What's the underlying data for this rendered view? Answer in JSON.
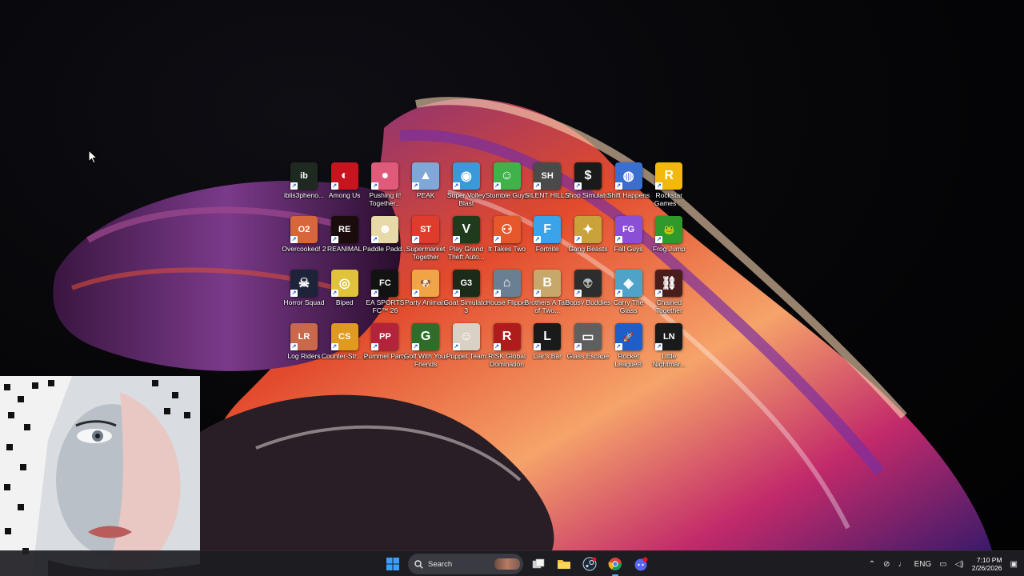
{
  "desktop": {
    "icons": [
      {
        "label": "iblis3pheno...",
        "color": "#1e2a20",
        "glyph": "ib",
        "icon": "iblis-icon"
      },
      {
        "label": "Among Us",
        "color": "#c8141e",
        "glyph": "◐",
        "icon": "among-us-icon"
      },
      {
        "label": "Pushing it! Together...",
        "color": "#e05a7a",
        "glyph": "●",
        "icon": "pushing-it-icon"
      },
      {
        "label": "PEAK",
        "color": "#7fa8d6",
        "glyph": "▲",
        "icon": "peak-icon"
      },
      {
        "label": "Super Volley Blast",
        "color": "#3a9ad9",
        "glyph": "◉",
        "icon": "volleyball-icon"
      },
      {
        "label": "Stumble Guys",
        "color": "#3fb24a",
        "glyph": "☺",
        "icon": "stumble-guys-icon"
      },
      {
        "label": "SILENT HILL 2",
        "color": "#4a4a4a",
        "glyph": "SH",
        "icon": "silent-hill-icon"
      },
      {
        "label": "Shop Simulator",
        "color": "#1a1a1a",
        "glyph": "$",
        "icon": "shop-simulator-icon"
      },
      {
        "label": "Shift Happens",
        "color": "#3a6fd0",
        "glyph": "◍",
        "icon": "shift-happens-icon"
      },
      {
        "label": "Rockstar Games ...",
        "color": "#f2b90c",
        "glyph": "R",
        "icon": "rockstar-icon"
      },
      {
        "label": "Overcooked! 2",
        "color": "#d7663b",
        "glyph": "O2",
        "icon": "overcooked-icon"
      },
      {
        "label": "REANIMAL",
        "color": "#1a0c0c",
        "glyph": "RE",
        "icon": "reanimal-icon"
      },
      {
        "label": "Paddle Padd...",
        "color": "#e7d9a8",
        "glyph": "☻",
        "icon": "paddle-icon"
      },
      {
        "label": "Supermarket Together",
        "color": "#e03c2e",
        "glyph": "ST",
        "icon": "supermarket-icon"
      },
      {
        "label": "Play Grand Theft Auto...",
        "color": "#1f3b1c",
        "glyph": "V",
        "icon": "gta-icon"
      },
      {
        "label": "It Takes Two",
        "color": "#e6572b",
        "glyph": "⚇",
        "icon": "it-takes-two-icon"
      },
      {
        "label": "Fortnite",
        "color": "#3aa4ea",
        "glyph": "F",
        "icon": "fortnite-icon"
      },
      {
        "label": "Gang Beasts",
        "color": "#c9a23a",
        "glyph": "✦",
        "icon": "gang-beasts-icon"
      },
      {
        "label": "Fall Guys",
        "color": "#8b4fd6",
        "glyph": "FG",
        "icon": "fall-guys-icon"
      },
      {
        "label": "Frog Jump",
        "color": "#2f9a2b",
        "glyph": "🐸",
        "icon": "frog-jump-icon"
      },
      {
        "label": "Horror Squad",
        "color": "#1d2338",
        "glyph": "☠",
        "icon": "horror-squad-icon"
      },
      {
        "label": "Biped",
        "color": "#e1c33b",
        "glyph": "◎",
        "icon": "biped-icon"
      },
      {
        "label": "EA SPORTS FC™ 26",
        "color": "#121212",
        "glyph": "FC",
        "icon": "ea-fc-icon"
      },
      {
        "label": "Party Animals",
        "color": "#f0a446",
        "glyph": "🐶",
        "icon": "party-animals-icon"
      },
      {
        "label": "Goat Simulator 3",
        "color": "#1c2a1a",
        "glyph": "G3",
        "icon": "goat-sim-icon"
      },
      {
        "label": "House Flipper",
        "color": "#6b7f93",
        "glyph": "⌂",
        "icon": "house-flipper-icon"
      },
      {
        "label": "Brothers A Tale of Two...",
        "color": "#c8a86a",
        "glyph": "B",
        "icon": "brothers-icon"
      },
      {
        "label": "Bopsy Buddies",
        "color": "#2d2d2d",
        "glyph": "👽",
        "icon": "bopsy-icon"
      },
      {
        "label": "Carry The Glass",
        "color": "#4fa3c9",
        "glyph": "◈",
        "icon": "carry-glass-icon"
      },
      {
        "label": "Chained Together",
        "color": "#4a1d1d",
        "glyph": "⛓",
        "icon": "chained-icon"
      },
      {
        "label": "Log Riders",
        "color": "#c9684a",
        "glyph": "LR",
        "icon": "log-riders-icon"
      },
      {
        "label": "Counter-Str... 2",
        "color": "#e09a1f",
        "glyph": "CS",
        "icon": "counter-strike-icon"
      },
      {
        "label": "Pummel Party",
        "color": "#b3243b",
        "glyph": "PP",
        "icon": "pummel-party-icon"
      },
      {
        "label": "Golf With Your Friends",
        "color": "#2e6e2a",
        "glyph": "G",
        "icon": "golf-icon"
      },
      {
        "label": "Puppet Team",
        "color": "#d9d1c5",
        "glyph": "☺",
        "icon": "puppet-team-icon"
      },
      {
        "label": "RISK Global Domination",
        "color": "#b01c1c",
        "glyph": "R",
        "icon": "risk-icon"
      },
      {
        "label": "Liar's Bar",
        "color": "#1a1a1a",
        "glyph": "L",
        "icon": "liars-bar-icon"
      },
      {
        "label": "Glass Escape",
        "color": "#5f5f5f",
        "glyph": "▭",
        "icon": "glass-escape-icon"
      },
      {
        "label": "Rocket League®",
        "color": "#1d5ec9",
        "glyph": "🚀",
        "icon": "rocket-league-icon"
      },
      {
        "label": "Little Nightmar...",
        "color": "#1a1a1a",
        "glyph": "LN",
        "icon": "little-nightmares-icon"
      }
    ]
  },
  "taskbar": {
    "search_placeholder": "Search",
    "tray": {
      "language": "ENG",
      "time": "7:10 PM",
      "date": "2/26/2026"
    }
  }
}
